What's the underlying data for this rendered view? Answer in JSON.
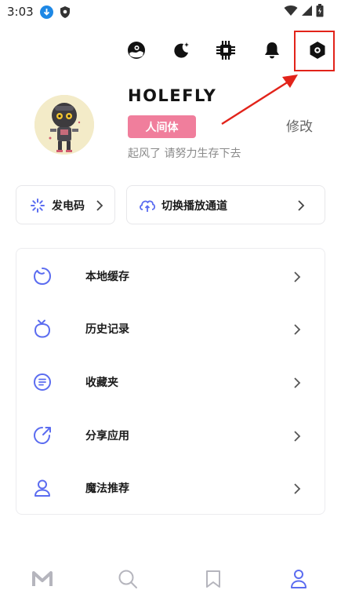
{
  "status_bar": {
    "time": "3:03"
  },
  "top_icons": [
    "landscape-icon",
    "night-mode-icon",
    "chip-icon",
    "bell-icon",
    "settings-hex-icon"
  ],
  "profile": {
    "name": "HOLEFLY",
    "tag": "人间体",
    "edit": "修改",
    "signature": "起风了 请努力生存下去"
  },
  "actions": {
    "power_code": "发电码",
    "switch_channel": "切换播放通道"
  },
  "menu": [
    {
      "label": "本地缓存",
      "icon": "local-cache-icon"
    },
    {
      "label": "历史记录",
      "icon": "tv-history-icon"
    },
    {
      "label": "收藏夹",
      "icon": "favorites-icon"
    },
    {
      "label": "分享应用",
      "icon": "share-icon"
    },
    {
      "label": "魔法推荐",
      "icon": "user-icon"
    }
  ],
  "colors": {
    "accent": "#5b6cf0",
    "tag_pink": "#f07e9c",
    "highlight_red": "#e2231a"
  },
  "bottom_nav": [
    "home-m-icon",
    "search-icon",
    "bookmark-icon",
    "profile-icon"
  ]
}
